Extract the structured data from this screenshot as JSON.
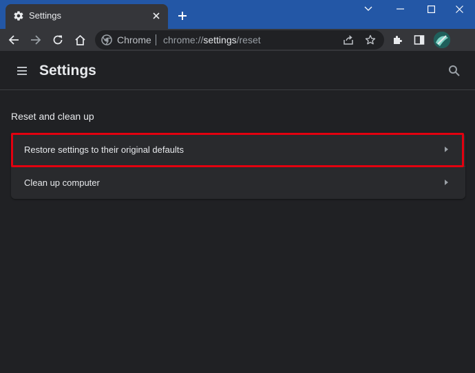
{
  "browser": {
    "tab": {
      "title": "Settings",
      "favicon": "gear-icon"
    },
    "window_controls": [
      "chevron-down-icon",
      "minimize-icon",
      "maximize-icon",
      "close-icon"
    ],
    "omnibox": {
      "site_label": "Chrome",
      "url_prefix": "chrome://",
      "url_host": "settings",
      "url_path": "/reset"
    },
    "colors": {
      "tabstrip": "#2357a6",
      "toolbar": "#35363a",
      "page": "#202124"
    }
  },
  "settings": {
    "header": {
      "title": "Settings"
    },
    "section": {
      "title": "Reset and clean up",
      "items": [
        {
          "label": "Restore settings to their original defaults",
          "highlighted": true
        },
        {
          "label": "Clean up computer",
          "highlighted": false
        }
      ]
    },
    "highlight_color": "#e3000f"
  }
}
